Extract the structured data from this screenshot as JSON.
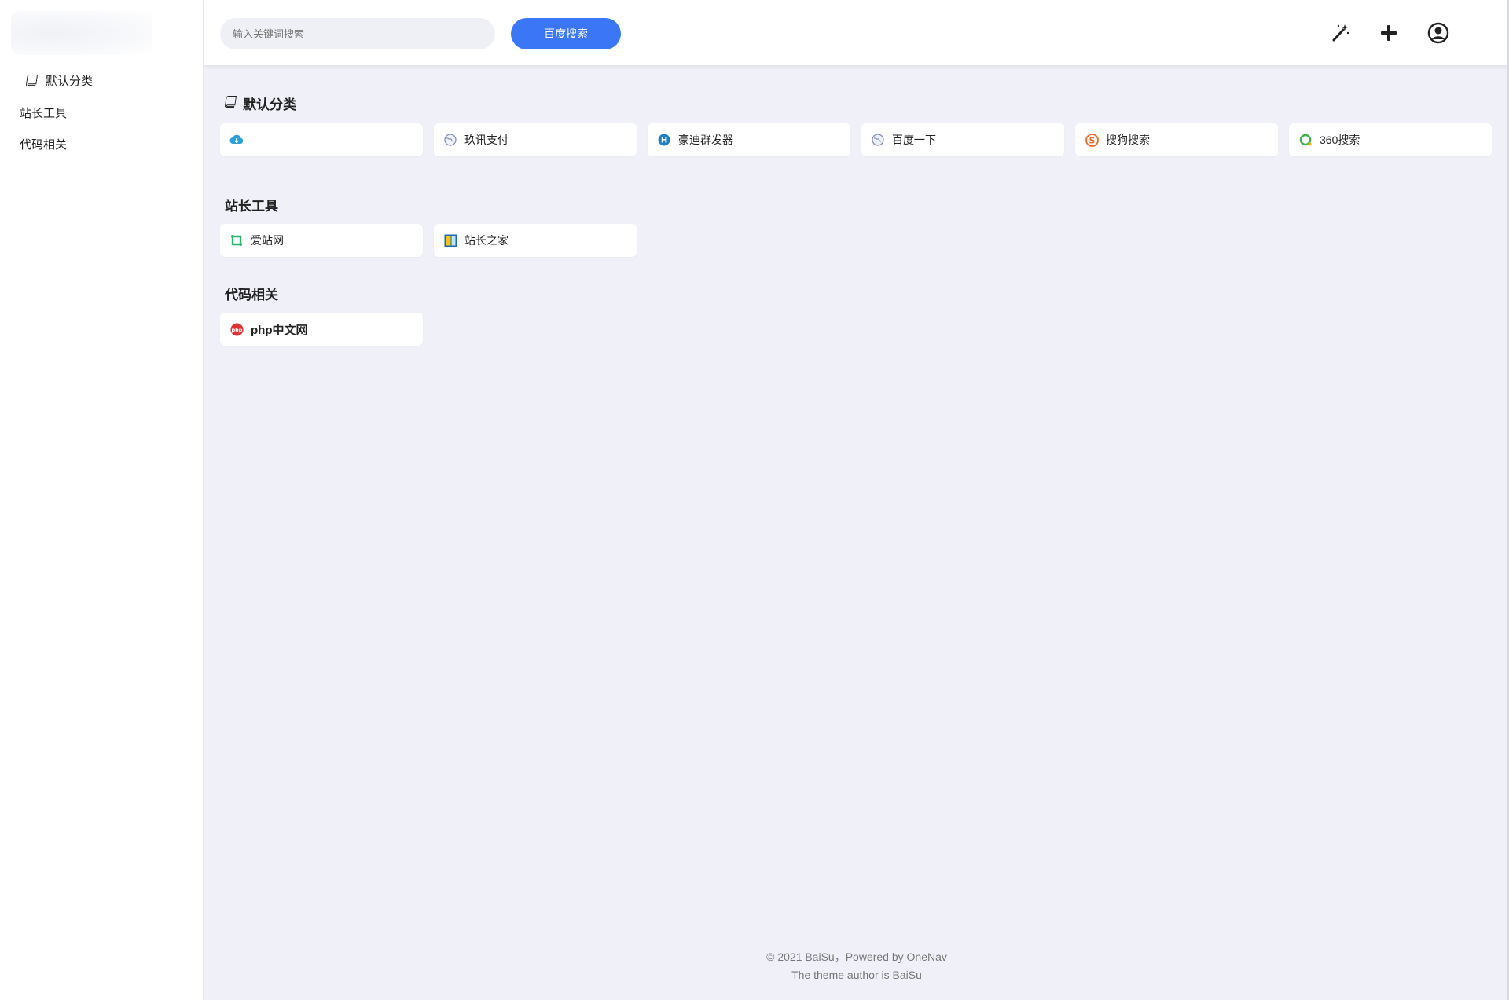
{
  "sidebar": {
    "items": [
      {
        "label": "默认分类",
        "icon": "book-icon"
      },
      {
        "label": "站长工具"
      },
      {
        "label": "代码相关"
      }
    ]
  },
  "header": {
    "search": {
      "placeholder": "输入关键词搜索",
      "value": ""
    },
    "search_button": "百度搜索",
    "icons": [
      "magic-wand-icon",
      "plus-icon",
      "user-circle-icon"
    ]
  },
  "sections": [
    {
      "title": "默认分类",
      "icon": "book-icon",
      "links": [
        {
          "label": "",
          "icon": "cloud-download-icon"
        },
        {
          "label": "玖讯支付",
          "icon": "globe-icon"
        },
        {
          "label": "豪迪群发器",
          "icon": "h-logo-icon"
        },
        {
          "label": "百度一下",
          "icon": "globe-icon"
        },
        {
          "label": "搜狗搜索",
          "icon": "sogou-icon"
        },
        {
          "label": "360搜索",
          "icon": "360-icon"
        }
      ]
    },
    {
      "title": "站长工具",
      "links": [
        {
          "label": "爱站网",
          "icon": "aizhan-icon"
        },
        {
          "label": "站长之家",
          "icon": "chinaz-icon"
        }
      ]
    },
    {
      "title": "代码相关",
      "links": [
        {
          "label": "php中文网",
          "icon": "php-icon"
        }
      ]
    }
  ],
  "footer": {
    "line1": "© 2021 BaiSu，Powered by OneNav",
    "line2": "The theme author is BaiSu"
  },
  "colors": {
    "accent": "#3b76f6",
    "background": "#f0f1f8"
  }
}
